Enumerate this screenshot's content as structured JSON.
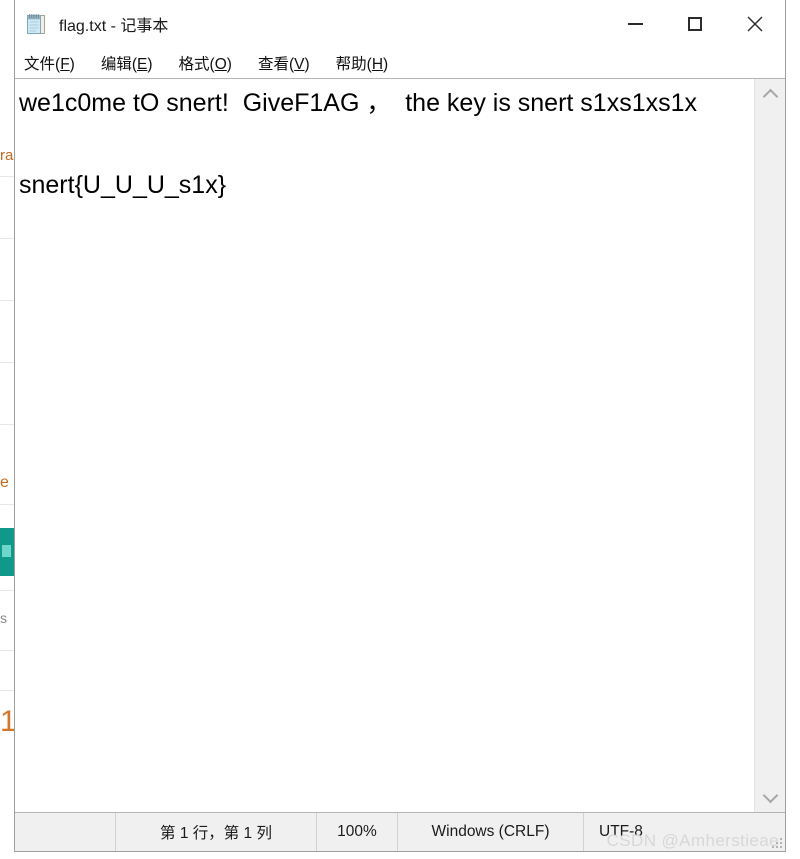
{
  "window": {
    "title": "flag.txt - 记事本",
    "icon": "notepad-icon",
    "controls": {
      "minimize_label": "最小化",
      "maximize_label": "最大化",
      "close_label": "关闭"
    }
  },
  "menu": {
    "items": [
      {
        "label": "文件",
        "accel": "F"
      },
      {
        "label": "编辑",
        "accel": "E"
      },
      {
        "label": "格式",
        "accel": "O"
      },
      {
        "label": "查看",
        "accel": "V"
      },
      {
        "label": "帮助",
        "accel": "H"
      }
    ]
  },
  "editor": {
    "content": "we1c0me tO snert!  GiveF1AG ，  the key is snert s1xs1xs1x\n\nsnert{U_U_U_s1x}",
    "scrollbar": {
      "up_arrow": "chevron-up-icon",
      "down_arrow": "chevron-down-icon"
    }
  },
  "status_bar": {
    "spacer": "",
    "position": "第 1 行，第 1 列",
    "zoom": "100%",
    "line_ending": "Windows (CRLF)",
    "encoding": "UTF-8"
  },
  "watermark": {
    "text": "CSDN @Amherstieae"
  },
  "background": {
    "fragment_ra": "ra",
    "fragment_e": "e",
    "fragment_s": "s",
    "fragment_one": "1"
  },
  "colors": {
    "window_border": "#a0a0a0",
    "status_bar_bg": "#f0f0f0",
    "teal_accent": "#10998b",
    "close_hover": "#e81123",
    "text": "#000000"
  }
}
